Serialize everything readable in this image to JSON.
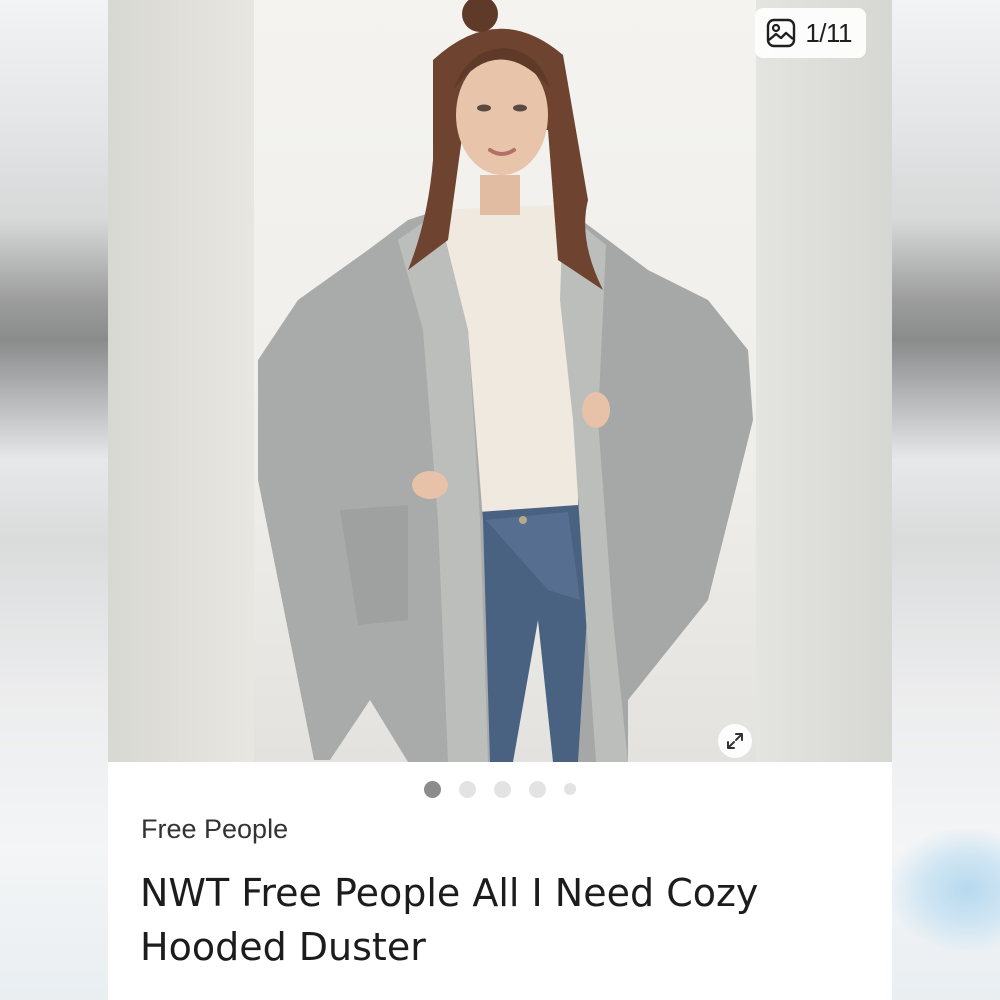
{
  "listing": {
    "image_counter": "1/11",
    "brand": "Free People",
    "title": "NWT Free People All I Need Cozy Hooded Duster",
    "carousel_dots": 5,
    "active_dot": 0
  },
  "icons": {
    "gallery": "image-gallery-icon",
    "expand": "expand-arrows-icon"
  },
  "colors": {
    "active_dot": "#8c8c8c",
    "inactive_dot": "#e3e3e3"
  }
}
